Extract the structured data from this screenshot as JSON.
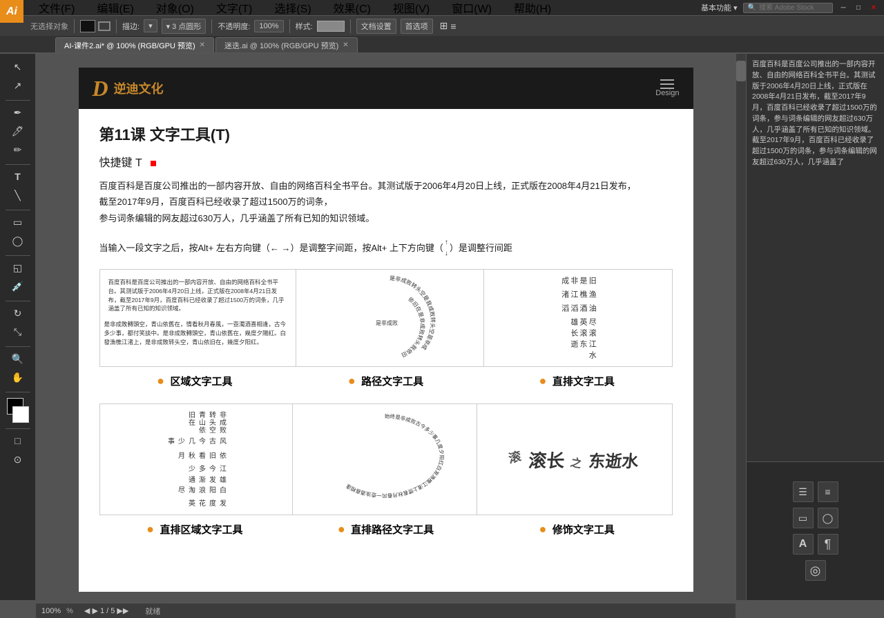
{
  "app": {
    "logo": "Ai",
    "title": "Adobe Illustrator"
  },
  "menu": {
    "items": [
      "文件(F)",
      "编辑(E)",
      "对象(O)",
      "文字(T)",
      "选择(S)",
      "效果(C)",
      "视图(V)",
      "窗口(W)",
      "帮助(H)"
    ]
  },
  "toolbar_top": {
    "no_selection": "无选择对象",
    "stroke_label": "描边:",
    "points_label": "▾ 3 点圆形",
    "opacity_label": "不透明度:",
    "opacity_value": "100%",
    "style_label": "样式:",
    "doc_settings": "文档设置",
    "preferences": "首选项"
  },
  "tabs": [
    {
      "label": "AI-课件2.ai* @ 100% (RGB/GPU 预览)",
      "active": true
    },
    {
      "label": "迷迭.ai @ 100% (RGB/GPU 预览)",
      "active": false
    }
  ],
  "right_panel_text": "百度百科是百度公司推出的一部内容开放、自由的网络百科全书平台。其测试版于2006年4月20日上线，正式版在2008年4月21日发布，截至2017年9月，百度百科已经收录了超过1500万的词条，参与词条编辑的网友超过630万人，几乎涵盖了所有已知的知识领域。截至2017年9月，百度百科已经收录了超过1500万的词条，参与词条编辑的网友超过630万人，几乎涵盖了",
  "doc": {
    "logo_symbol": "D",
    "logo_text": "逆迪文化",
    "header_label": "Design",
    "title": "第11课   文字工具(T)",
    "shortcut": "快捷键 T",
    "body_text": "百度百科是百度公司推出的一部内容开放、自由的网络百科全书平台。其测试版于2006年4月20日上线，正式版在2008年4月21日发布，\n截至2017年9月，百度百科已经收录了超过1500万的词条，\n参与词条编辑的网友超过630万人，几乎涵盖了所有已知的知识领域。",
    "instruction": "当输入一段文字之后，按Alt+ 左右方向键（← →）是调整字间距，按Alt+ 上下方向键（  ）是调整行间距",
    "tools": [
      {
        "label": "区域文字工具",
        "type": "zone"
      },
      {
        "label": "路径文字工具",
        "type": "path"
      },
      {
        "label": "直排文字工具",
        "type": "vertical"
      }
    ],
    "tools2": [
      {
        "label": "直排区域文字工具",
        "type": "zone_v"
      },
      {
        "label": "直排路径文字工具",
        "type": "path_v"
      },
      {
        "label": "修饰文字工具",
        "type": "decor"
      }
    ],
    "zone_sample": "百度百科是百度公司推出的一部内容开放、自由的网络百科全书平台。其测试版于2006年4月20日上线，正式版在2008年4月21日发布，截至2017年9月，百度百科已经收录了超过1500万的词条，几乎涵盖了所有已知的知识领域。",
    "zone_sample2": "是非成败转头空，青山依旧在，几度夕阳红。白发渔樵江渚上，惯看秋月春风。",
    "path_sample": "是非成败转头空是我成败转头空依旧在",
    "vertical_sample": "滚滚长江东逝水旧是非成败转头空渔樵江渚上油酒滔滔喜相逢尽英雄",
    "vertical_sample2": "非成败转头空青山依旧在几度夕阳红白发渔樵江渚上惯看秋月春风",
    "decor_sample": "滚长 东逝水"
  },
  "bottom_bar": {
    "zoom": "100%",
    "page_info": "◀ ▶ 1 / 5 ▶▶",
    "status": "就绪"
  }
}
